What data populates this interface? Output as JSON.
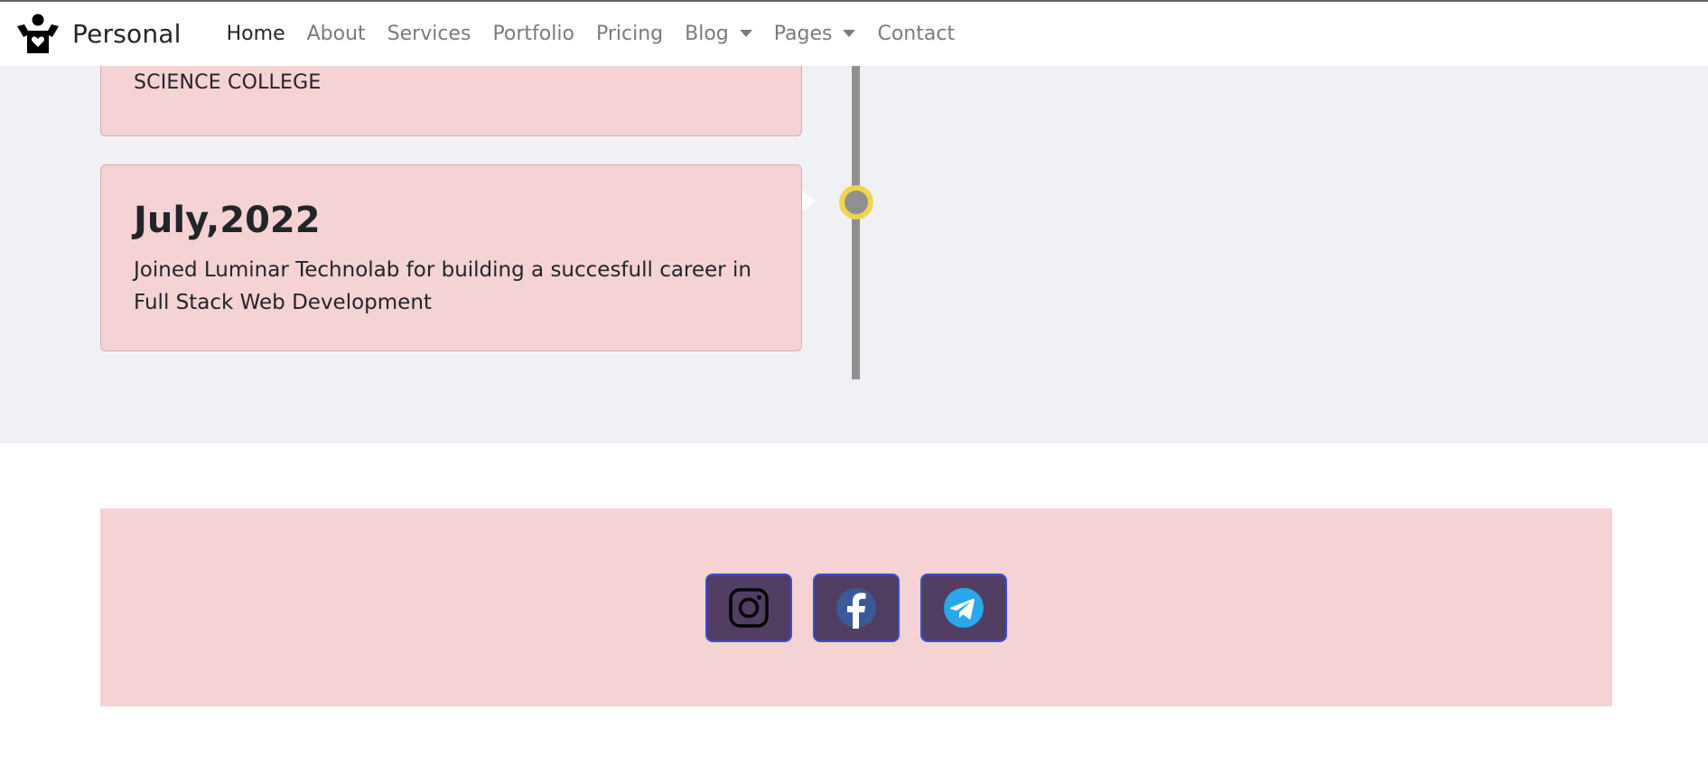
{
  "navbar": {
    "brand": "Personal",
    "links": [
      {
        "label": "Home",
        "active": true
      },
      {
        "label": "About"
      },
      {
        "label": "Services"
      },
      {
        "label": "Portfolio"
      },
      {
        "label": "Pricing"
      },
      {
        "label": "Blog",
        "dropdown": true
      },
      {
        "label": "Pages",
        "dropdown": true
      },
      {
        "label": "Contact"
      }
    ]
  },
  "timeline": {
    "previous_item_text": "SCIENCE COLLEGE",
    "current_item": {
      "date": "July,2022",
      "description": "Joined Luminar Technolab for building a succesfull career in Full Stack Web Development"
    },
    "marker_color": "#f3d44e"
  },
  "footer": {
    "social": [
      {
        "name": "instagram-icon"
      },
      {
        "name": "facebook-icon"
      },
      {
        "name": "telegram-icon"
      }
    ]
  },
  "colors": {
    "card_background": "#f5d2d3",
    "section_background": "#f0f1f5",
    "social_button_background": "#523d63",
    "social_button_border": "#3a4fd0"
  }
}
